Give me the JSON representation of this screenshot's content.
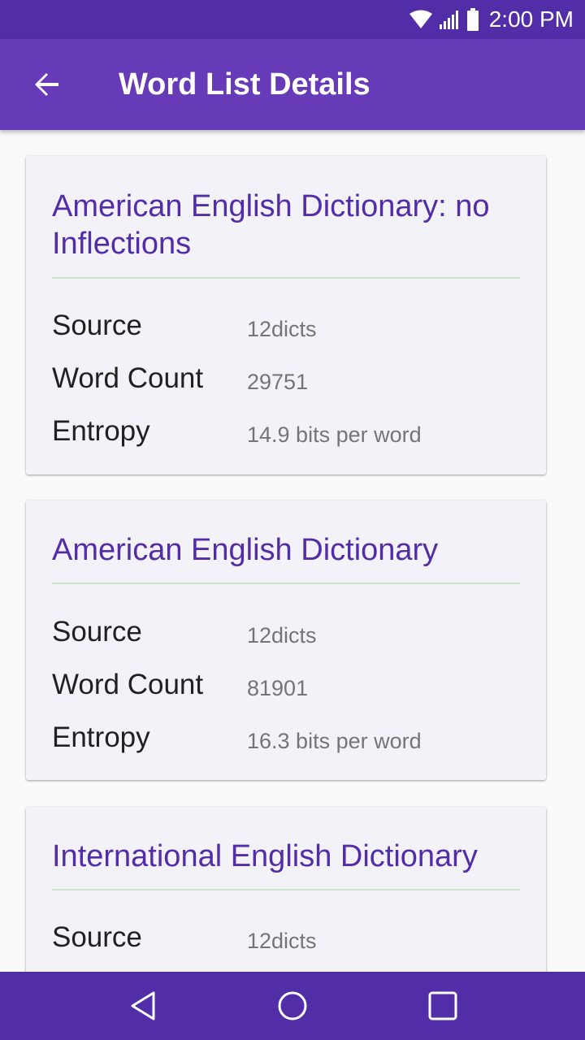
{
  "status_bar": {
    "time": "2:00 PM",
    "icons": [
      "wifi-icon",
      "signal-icon",
      "battery-icon"
    ]
  },
  "app_bar": {
    "title": "Word List Details",
    "back_icon": "arrow-back-icon"
  },
  "cards": [
    {
      "title": "American English Dictionary: no Inflections",
      "rows": [
        {
          "label": "Source",
          "value": "12dicts"
        },
        {
          "label": "Word Count",
          "value": "29751"
        },
        {
          "label": "Entropy",
          "value": "14.9 bits per word"
        }
      ]
    },
    {
      "title": "American English Dictionary",
      "rows": [
        {
          "label": "Source",
          "value": "12dicts"
        },
        {
          "label": "Word Count",
          "value": "81901"
        },
        {
          "label": "Entropy",
          "value": "16.3 bits per word"
        }
      ]
    },
    {
      "title": "International English Dictionary",
      "rows": [
        {
          "label": "Source",
          "value": "12dicts"
        }
      ]
    }
  ],
  "nav_bar": {
    "icons": [
      "back-triangle-icon",
      "home-circle-icon",
      "recents-square-icon"
    ]
  },
  "colors": {
    "primary": "#673ab7",
    "primary_dark": "#512da8",
    "card_background": "#f4f2f9",
    "divider": "#c8e6c9"
  }
}
